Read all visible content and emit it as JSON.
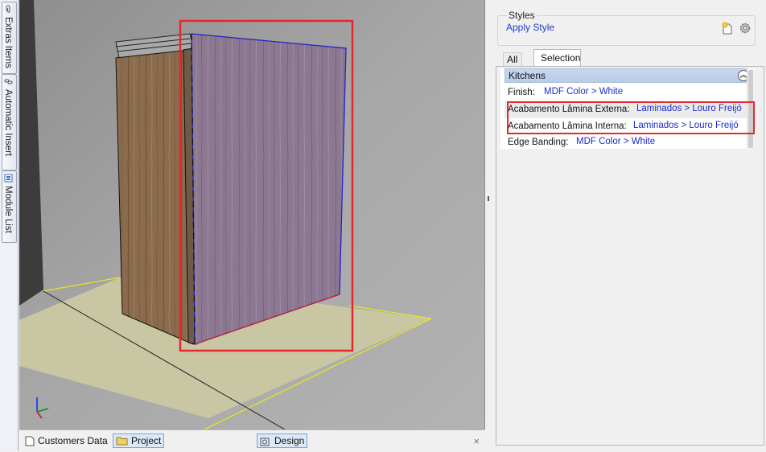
{
  "side_tabs": [
    {
      "label": "Extras Items",
      "icon": "paperclip-icon"
    },
    {
      "label": "Automatic Insert",
      "icon": "link-icon"
    },
    {
      "label": "Module List",
      "icon": "module-list-icon"
    }
  ],
  "bottom_tabs": [
    {
      "label": "Customers Data",
      "icon": "document-icon",
      "active": false
    },
    {
      "label": "Project",
      "icon": "folder-icon",
      "active": true
    },
    {
      "label": "Design",
      "icon": "design-icon",
      "active": true
    }
  ],
  "bottom_close": "×",
  "styles": {
    "group_title": "Styles",
    "apply_style": "Apply Style",
    "new_icon": "new-style-icon",
    "settings_icon": "gear-icon"
  },
  "panel_tabs": {
    "all": "All",
    "selection": "Selection"
  },
  "grid": {
    "category": "Kitchens",
    "collapse_glyph": "︽",
    "rows": [
      {
        "name": "Finish:",
        "value": "MDF Color > White"
      },
      {
        "name": "Acabamento Lâmina Externa:",
        "value": "Laminados > Louro Freijó"
      },
      {
        "name": "Acabamento Lâmina Interna:",
        "value": "Laminados > Louro Freijó"
      },
      {
        "name": "Edge Banding:",
        "value": "MDF Color > White"
      }
    ]
  },
  "colors": {
    "highlight": "#e8262f",
    "link": "#1a2bd0",
    "front_panel": "#8b7590",
    "side_panel": "#8a6a4c",
    "floor": "#c9c6a4"
  }
}
